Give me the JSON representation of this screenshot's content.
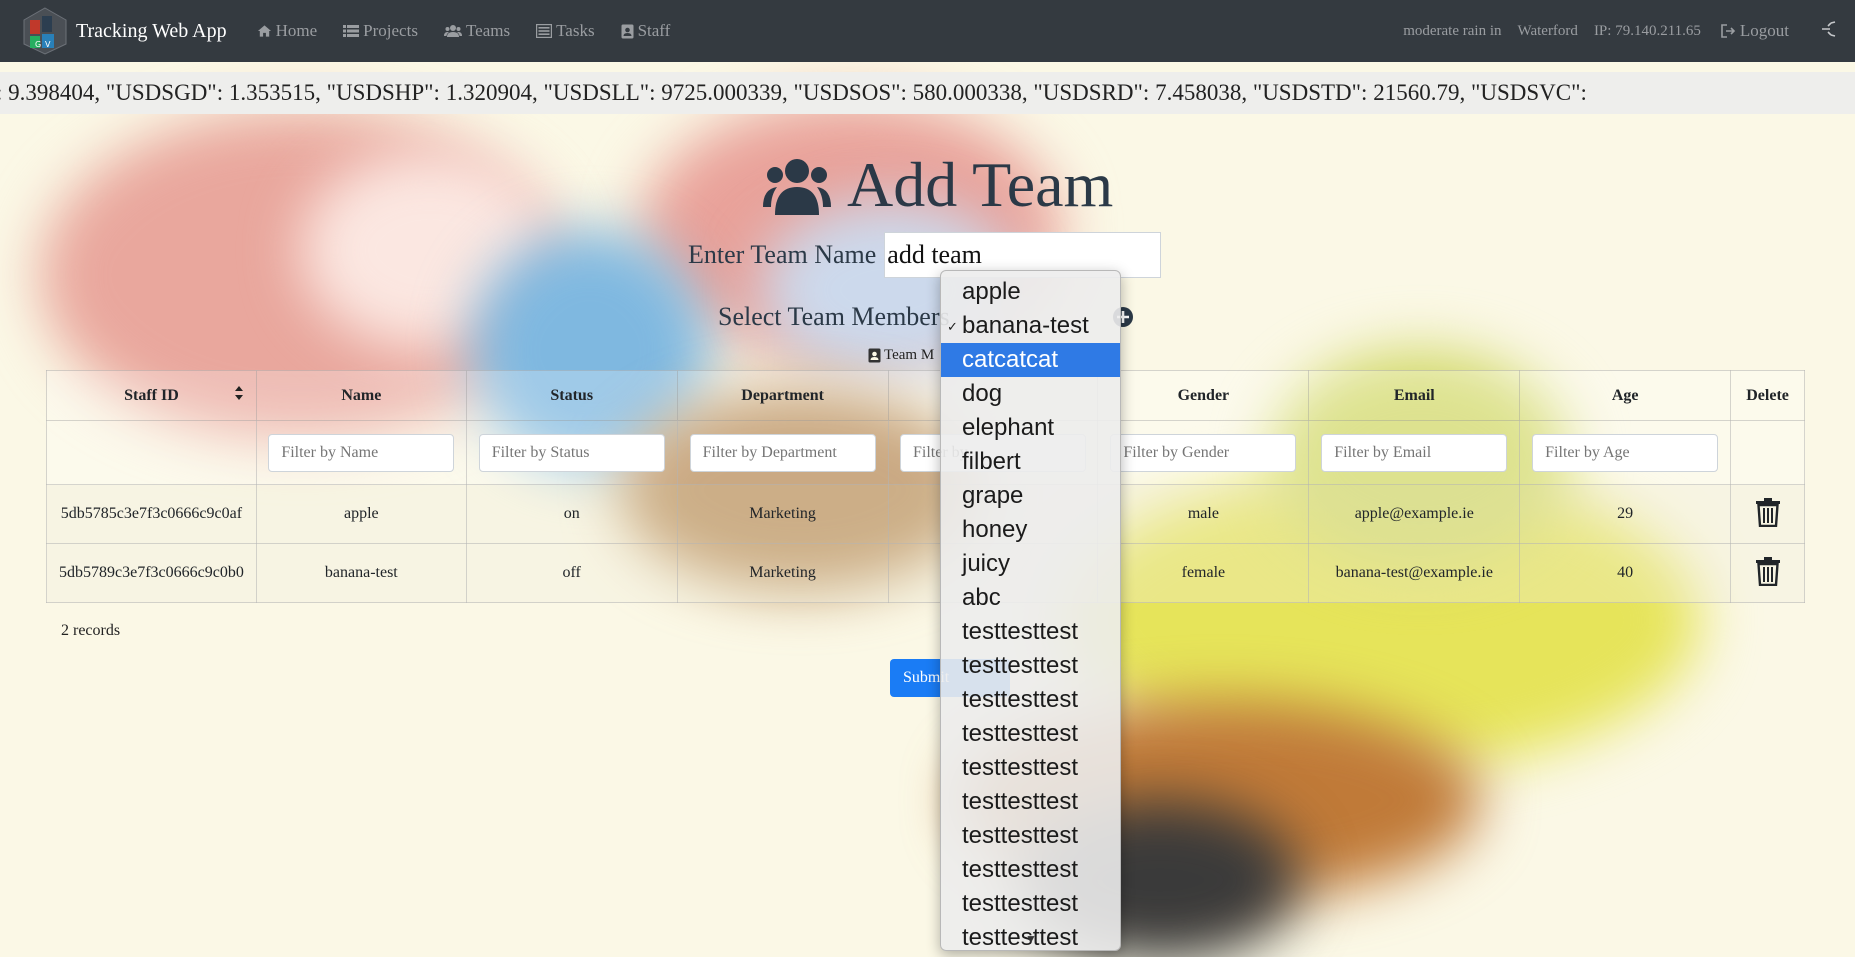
{
  "app": {
    "brand": "Tracking Web App"
  },
  "nav": {
    "home": "Home",
    "projects": "Projects",
    "teams": "Teams",
    "tasks": "Tasks",
    "staff": "Staff"
  },
  "header_info": {
    "weather": "moderate rain in",
    "city": "Waterford",
    "ip": "IP: 79.140.211.65",
    "logout": "Logout"
  },
  "ticker": ": 9.398404, \"USDSGD\": 1.353515, \"USDSHP\": 1.320904, \"USDSLL\": 9725.000339, \"USDSOS\": 580.000338, \"USDSRD\": 7.458038, \"USDSTD\": 21560.79, \"USDSVC\": ",
  "page": {
    "title": "Add Team",
    "team_name_label": "Enter Team Name",
    "team_name_value": "add team",
    "members_label": "Select Team Members",
    "team_members_tag": "Team M",
    "records": "2 records",
    "submit": "Submit"
  },
  "table": {
    "headers": [
      "Staff ID",
      "Name",
      "Status",
      "Department",
      "",
      "Gender",
      "Email",
      "Age",
      "Delete"
    ],
    "filters": [
      "",
      "Filter by Name",
      "Filter by Status",
      "Filter by Department",
      "Filter by",
      "Filter by Gender",
      "Filter by Email",
      "Filter by Age",
      ""
    ],
    "rows": [
      [
        "5db5785c3e7f3c0666c9c0af",
        "apple",
        "on",
        "Marketing",
        "",
        "male",
        "apple@example.ie",
        "29"
      ],
      [
        "5db5789c3e7f3c0666c9c0b0",
        "banana-test",
        "off",
        "Marketing",
        "",
        "female",
        "banana-test@example.ie",
        "40"
      ]
    ]
  },
  "dropdown": {
    "options": [
      "apple",
      "banana-test",
      "catcatcat",
      "dog",
      "elephant",
      "filbert",
      "grape",
      "honey",
      "juicy",
      "abc",
      "testtesttest",
      "testtesttest",
      "testtesttest",
      "testtesttest",
      "testtesttest",
      "testtesttest",
      "testtesttest",
      "testtesttest",
      "testtesttest",
      "testtesttest"
    ],
    "checked_index": 1,
    "highlighted_index": 2
  }
}
